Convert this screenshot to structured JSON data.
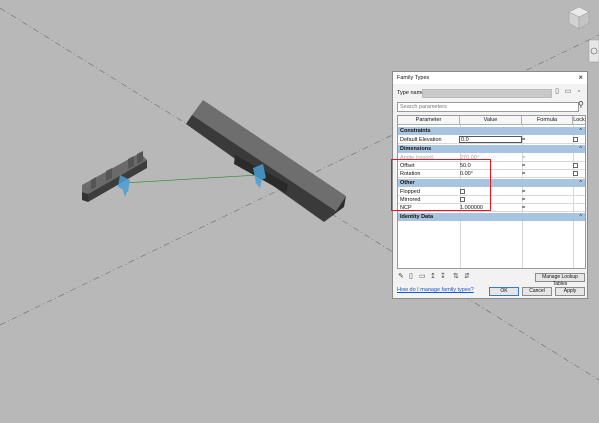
{
  "dialog": {
    "title": "Family Types",
    "close_glyph": "×",
    "type_name_label": "Type name:",
    "search_placeholder": "Search parameters",
    "columns": [
      "Parameter",
      "Value",
      "Formula",
      "Lock"
    ],
    "groups": {
      "constraints": "Constraints",
      "dimensions": "Dimensions",
      "other": "Other",
      "identity": "Identity Data",
      "toggle": "^"
    },
    "rows": {
      "default_elevation": {
        "name": "Default Elevation",
        "value": "0.0",
        "formula": "="
      },
      "angle": {
        "name": "Angle (report)",
        "value": "270.00°",
        "formula": "="
      },
      "offset": {
        "name": "Offset",
        "value": "50.0",
        "formula": "="
      },
      "rotation": {
        "name": "Rotation",
        "value": "0.00°",
        "formula": "="
      },
      "flopped": {
        "name": "Flopped",
        "formula": "="
      },
      "mirrored": {
        "name": "Mirrored",
        "formula": "="
      },
      "ncp": {
        "name": "NCP",
        "value": "1.000000",
        "formula": "="
      }
    },
    "buttons": {
      "lookup": "Manage Lookup Tables",
      "ok": "OK",
      "cancel": "Cancel",
      "apply": "Apply"
    },
    "help_link": "How do I manage family types?"
  },
  "icons": [
    "new-type-icon",
    "rename-type-icon",
    "delete-type-icon",
    "edit-parameter-icon",
    "new-parameter-icon",
    "delete-parameter-icon",
    "move-up-icon",
    "move-down-icon",
    "sort-ascending-icon",
    "sort-descending-icon",
    "search-icon",
    "viewcube-icon"
  ],
  "colors": {
    "highlight": "#e11122",
    "group_header": "#a8c4e0",
    "link": "#1a55c8"
  }
}
